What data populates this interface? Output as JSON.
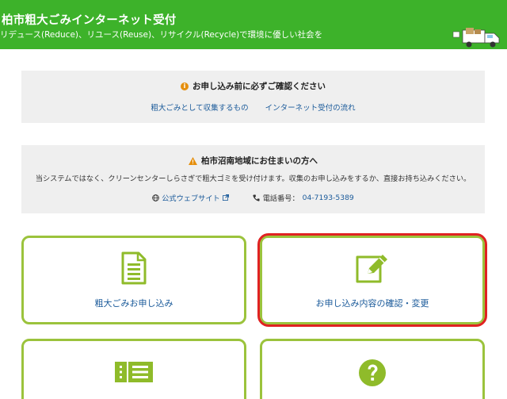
{
  "header": {
    "title": "柏市粗大ごみインターネット受付",
    "subtitle": "リデュース(Reduce)、リユース(Reuse)、リサイクル(Recycle)で環境に優しい社会を"
  },
  "notice1": {
    "heading": "お申し込み前に必ずご確認ください",
    "links": [
      "粗大ごみとして収集するもの",
      "インターネット受付の流れ"
    ]
  },
  "notice2": {
    "heading": "柏市沼南地域にお住まいの方へ",
    "text": "当システムではなく、クリーンセンターしらさぎで粗大ゴミを受け付けます。収集のお申し込みをするか、直接お持ち込みください。",
    "website_label": "公式ウェブサイト",
    "phone_label": "電話番号：",
    "phone_number": "04-7193-5389"
  },
  "cards": [
    {
      "label": "粗大ごみお申し込み",
      "icon": "document-icon"
    },
    {
      "label": "お申し込み内容の確認・変更",
      "icon": "edit-icon"
    },
    {
      "label": "",
      "icon": "ticket-list-icon"
    },
    {
      "label": "",
      "icon": "question-icon"
    }
  ],
  "colors": {
    "header": "#3db22a",
    "card_border": "#9bc33c",
    "link": "#1a5a9a",
    "highlight": "#e02222",
    "info": "#e58f0e"
  }
}
